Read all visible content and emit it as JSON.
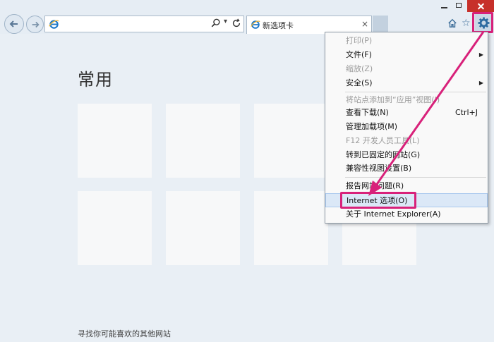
{
  "tab": {
    "label": "新选项卡",
    "close": "×"
  },
  "toolbar": {
    "address_value": "",
    "dropdown": "▾",
    "star": "☆"
  },
  "newtab": {
    "title": "常用",
    "footer": "寻找你可能喜欢的其他网站",
    "tile_count": 8
  },
  "menu": {
    "items": [
      {
        "label": "打印(P)",
        "disabled": true
      },
      {
        "label": "文件(F)",
        "submenu": true
      },
      {
        "label": "缩放(Z)",
        "disabled": true
      },
      {
        "label": "安全(S)",
        "submenu": true
      },
      {
        "label": "将站点添加到“应用”视图(I)",
        "disabled": true
      },
      {
        "label": "查看下载(N)",
        "shortcut": "Ctrl+J"
      },
      {
        "label": "管理加载项(M)"
      },
      {
        "label": "F12 开发人员工具(L)",
        "disabled": true
      },
      {
        "label": "转到已固定的网站(G)"
      },
      {
        "label": "兼容性视图设置(B)"
      },
      {
        "label": "报告网站问题(R)"
      },
      {
        "label": "Internet 选项(O)",
        "highlighted": true
      },
      {
        "label": "关于 Internet Explorer(A)"
      }
    ],
    "submenu_glyph": "▶"
  },
  "colors": {
    "accent": "#d8217a",
    "ie_blue": "#1e78c8",
    "close_red": "#c7302a"
  }
}
